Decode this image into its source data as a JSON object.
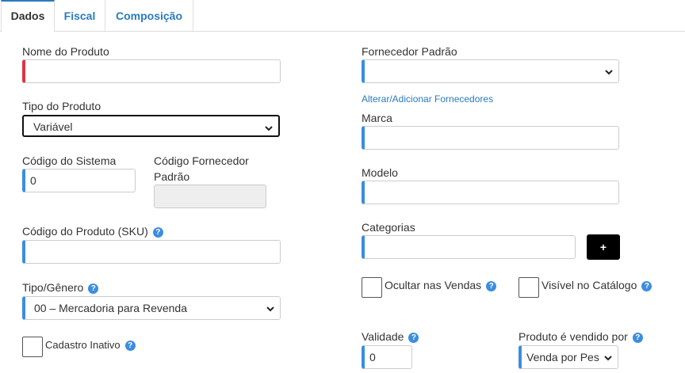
{
  "tabs": [
    {
      "label": "Dados"
    },
    {
      "label": "Fiscal"
    },
    {
      "label": "Composição"
    }
  ],
  "left": {
    "nome_label": "Nome do Produto",
    "nome_value": "",
    "tipo_label": "Tipo do Produto",
    "tipo_value": "Variável",
    "codigo_sistema_label": "Código do Sistema",
    "codigo_sistema_value": "0",
    "codigo_fornecedor_label_1": "Código Fornecedor",
    "codigo_fornecedor_label_2": "Padrão",
    "sku_label": "Código do Produto (SKU)",
    "sku_value": "",
    "genero_label": "Tipo/Gênero",
    "genero_value": "00 – Mercadoria para Revenda",
    "inativo_label": "Cadastro Inativo"
  },
  "right": {
    "fornecedor_label": "Fornecedor Padrão",
    "fornecedor_value": "",
    "fornecedor_link": "Alterar/Adicionar Fornecedores",
    "marca_label": "Marca",
    "modelo_label": "Modelo",
    "categorias_label": "Categorias",
    "plus_label": "+",
    "ocultar_label": "Ocultar nas Vendas",
    "visivel_label": "Visível no Catálogo",
    "validade_label": "Validade",
    "validade_value": "0",
    "vendido_label": "Produto é vendido por",
    "vendido_value": "Venda por Pes"
  },
  "colors": {
    "accent": "#3c8dde",
    "required": "#dc3545",
    "link": "#2a7bbd"
  }
}
